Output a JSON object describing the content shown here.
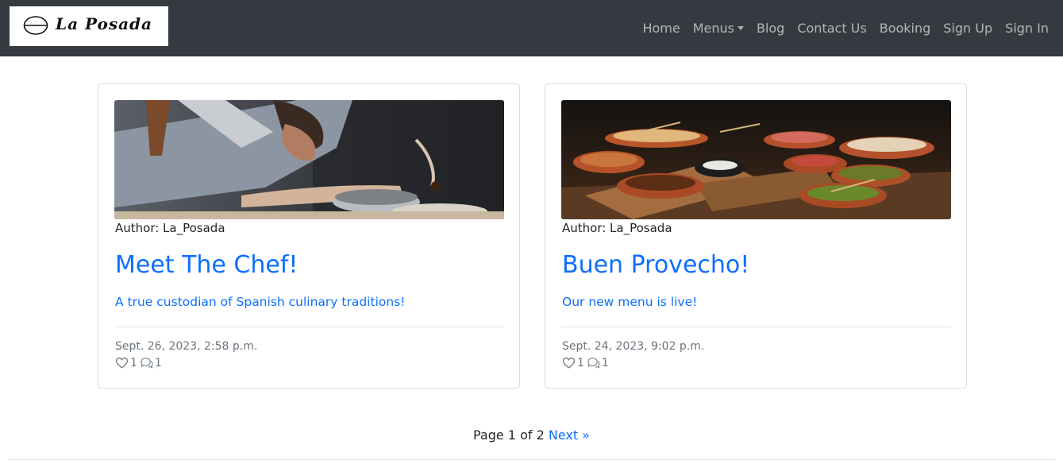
{
  "brand": {
    "name": "La Posada"
  },
  "nav": {
    "items": [
      {
        "label": "Home"
      },
      {
        "label": "Menus",
        "has_dropdown": true
      },
      {
        "label": "Blog"
      },
      {
        "label": "Contact Us"
      },
      {
        "label": "Booking"
      },
      {
        "label": "Sign Up"
      },
      {
        "label": "Sign In"
      }
    ]
  },
  "posts": [
    {
      "author": "Author: La_Posada",
      "title": "Meet The Chef!",
      "excerpt": "A true custodian of Spanish culinary traditions!",
      "date": "Sept. 26, 2023, 2:58 p.m.",
      "likes": "1",
      "comments": "1",
      "image_icon": "chef-photo"
    },
    {
      "author": "Author: La_Posada",
      "title": "Buen Provecho!",
      "excerpt": "Our new menu is live!",
      "date": "Sept. 24, 2023, 9:02 p.m.",
      "likes": "1",
      "comments": "1",
      "image_icon": "tapas-photo"
    }
  ],
  "pagination": {
    "status": "Page 1 of 2",
    "next_label": "Next »"
  },
  "colors": {
    "navbar": "#343a40",
    "link": "#0d6efd",
    "muted": "#6c757d",
    "nav_text": "#9a9da0"
  }
}
